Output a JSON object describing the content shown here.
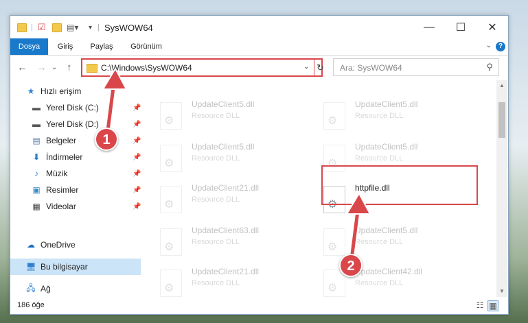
{
  "window": {
    "title": "SysWOW64"
  },
  "ribbon": {
    "tabs": [
      "Dosya",
      "Giriş",
      "Paylaş",
      "Görünüm"
    ]
  },
  "address": {
    "path": "C:\\Windows\\SysWOW64",
    "search_placeholder": "Ara: SysWOW64"
  },
  "nav": {
    "items": [
      {
        "label": "Hızlı erişim",
        "icon": "star-icon"
      },
      {
        "label": "Yerel Disk (C:)",
        "icon": "drive-icon",
        "pinned": true
      },
      {
        "label": "Yerel Disk (D:)",
        "icon": "drive-icon",
        "pinned": true
      },
      {
        "label": "Belgeler",
        "icon": "document-icon",
        "pinned": true
      },
      {
        "label": "İndirmeler",
        "icon": "download-icon",
        "pinned": true
      },
      {
        "label": "Müzik",
        "icon": "music-icon",
        "pinned": true
      },
      {
        "label": "Resimler",
        "icon": "pictures-icon",
        "pinned": true
      },
      {
        "label": "Videolar",
        "icon": "video-icon",
        "pinned": true
      },
      {
        "label": "OneDrive",
        "icon": "cloud-icon"
      },
      {
        "label": "Bu bilgisayar",
        "icon": "computer-icon",
        "selected": true
      },
      {
        "label": "Ağ",
        "icon": "network-icon"
      }
    ]
  },
  "files": [
    {
      "name": "UpdateClient5.dll",
      "type": "Resource DLL",
      "faded": true
    },
    {
      "name": "UpdateClient5.dll",
      "type": "Resource DLL",
      "faded": true
    },
    {
      "name": "UpdateClient5.dll",
      "type": "Resource DLL",
      "faded": true
    },
    {
      "name": "UpdateClient5.dll",
      "type": "Resource DLL",
      "faded": true
    },
    {
      "name": "UpdateClient21.dll",
      "type": "Resource DLL",
      "faded": true
    },
    {
      "name": "httpfile.dll",
      "type": "",
      "faded": false
    },
    {
      "name": "UpdateClient63.dll",
      "type": "Resource DLL",
      "faded": true
    },
    {
      "name": "UpdateClient5.dll",
      "type": "Resource DLL",
      "faded": true
    },
    {
      "name": "UpdateClient21.dll",
      "type": "Resource DLL",
      "faded": true
    },
    {
      "name": "UpdateClient42.dll",
      "type": "Resource DLL",
      "faded": true
    }
  ],
  "status": {
    "count": "186 öğe"
  },
  "annotations": {
    "step1": "1",
    "step2": "2",
    "color": "#d9474a"
  }
}
